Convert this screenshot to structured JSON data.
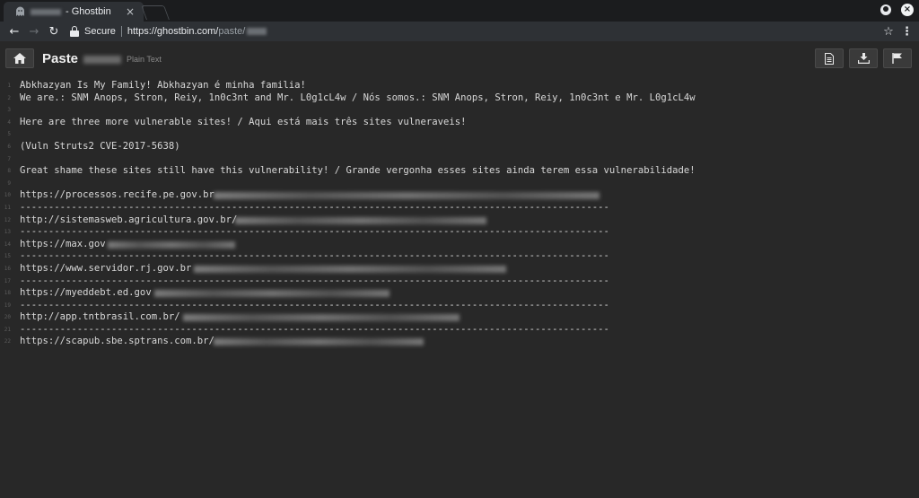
{
  "browser": {
    "tab_title": "- Ghostbin",
    "tab_close": "×",
    "secure_label": "Secure",
    "url_host": "https://ghostbin.com/",
    "url_path": "paste/",
    "close_glyph": "×",
    "back_glyph": "←",
    "forward_glyph": "→",
    "reload_glyph": "↻",
    "star_glyph": "☆",
    "menu_glyph": "⋮"
  },
  "paste": {
    "title": "Paste",
    "language": "Plain Text"
  },
  "lines": [
    {
      "num": "1",
      "text": "Abkhazyan Is My Family! Abkhazyan é minha familia!"
    },
    {
      "num": "2",
      "text": "We are.: SNM Anops, Stron, Reiy, 1n0c3nt and Mr. L0g1cL4w / Nós somos.: SNM Anops, Stron, Reiy, 1n0c3nt e Mr. L0g1cL4w"
    },
    {
      "num": "3",
      "text": ""
    },
    {
      "num": "4",
      "text": "Here are three more vulnerable sites! / Aqui está mais três sites vulneraveis!"
    },
    {
      "num": "5",
      "text": ""
    },
    {
      "num": "6",
      "text": "(Vuln Struts2 CVE-2017-5638)"
    },
    {
      "num": "7",
      "text": ""
    },
    {
      "num": "8",
      "text": "Great shame these sites still have this vulnerability! / Grande vergonha esses sites ainda terem essa vulnerabilidade!"
    },
    {
      "num": "9",
      "text": ""
    },
    {
      "num": "10",
      "text": "https://processos.recife.pe.gov.br"
    },
    {
      "num": "11",
      "text": "-------------------------------------------------------------------------------------------------------"
    },
    {
      "num": "12",
      "text": "http://sistemasweb.agricultura.gov.br/"
    },
    {
      "num": "13",
      "text": "-------------------------------------------------------------------------------------------------------"
    },
    {
      "num": "14",
      "text": "https://max.gov"
    },
    {
      "num": "15",
      "text": "-------------------------------------------------------------------------------------------------------"
    },
    {
      "num": "16",
      "text": "https://www.servidor.rj.gov.br"
    },
    {
      "num": "17",
      "text": "-------------------------------------------------------------------------------------------------------"
    },
    {
      "num": "18",
      "text": "https://myeddebt.ed.gov"
    },
    {
      "num": "19",
      "text": "-------------------------------------------------------------------------------------------------------"
    },
    {
      "num": "20",
      "text": "http://app.tntbrasil.com.br/"
    },
    {
      "num": "21",
      "text": "-------------------------------------------------------------------------------------------------------"
    },
    {
      "num": "22",
      "text": "https://scapub.sbe.sptrans.com.br/"
    }
  ]
}
